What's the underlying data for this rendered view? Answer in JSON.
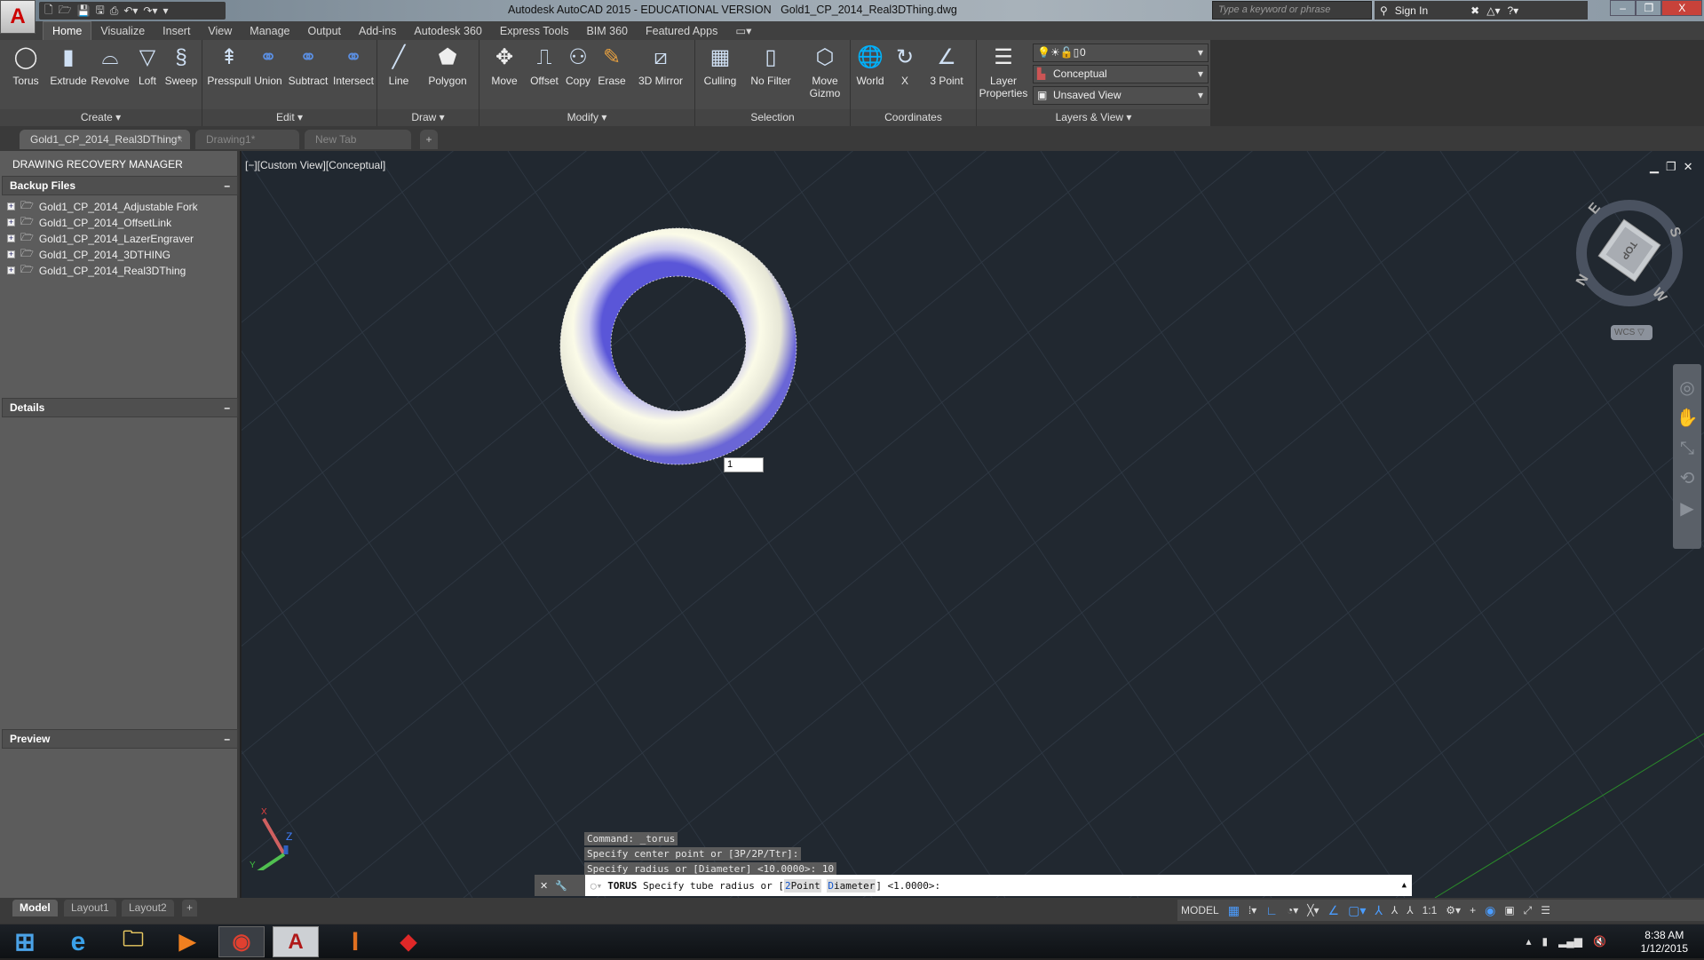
{
  "title_bar": {
    "app_title": "Autodesk AutoCAD 2015 - EDUCATIONAL VERSION",
    "document": "Gold1_CP_2014_Real3DThing.dwg",
    "search_placeholder": "Type a keyword or phrase",
    "sign_in": "Sign In",
    "window_buttons": [
      "–",
      "❐",
      "X"
    ]
  },
  "ribbon_tabs": [
    "Home",
    "Visualize",
    "Insert",
    "View",
    "Manage",
    "Output",
    "Add-ins",
    "Autodesk 360",
    "Express Tools",
    "BIM 360",
    "Featured Apps"
  ],
  "ribbon": {
    "panels": [
      "Create ▾",
      "Edit ▾",
      "Draw ▾",
      "Modify ▾",
      "Selection",
      "Coordinates",
      "Layers & View ▾"
    ],
    "buttons": {
      "torus": "Torus",
      "extrude": "Extrude",
      "revolve": "Revolve",
      "loft": "Loft",
      "sweep": "Sweep",
      "presspull": "Presspull",
      "union": "Union",
      "subtract": "Subtract",
      "intersect": "Intersect",
      "line": "Line",
      "polygon": "Polygon",
      "move": "Move",
      "offset": "Offset",
      "copy": "Copy",
      "erase": "Erase",
      "mirror3d": "3D Mirror",
      "culling": "Culling",
      "nofilter": "No Filter",
      "movegizmo": "Move Gizmo",
      "world": "World",
      "x": "X",
      "threepoint": "3 Point",
      "layerprops": "Layer Properties"
    },
    "layer_value": "0",
    "visual_style": "Conceptual",
    "view": "Unsaved View"
  },
  "doc_tabs": [
    "Gold1_CP_2014_Real3DThing*",
    "Drawing1*",
    "New Tab"
  ],
  "recovery": {
    "title": "DRAWING RECOVERY MANAGER",
    "backup_header": "Backup Files",
    "files": [
      "Gold1_CP_2014_Adjustable Fork",
      "Gold1_CP_2014_OffsetLink",
      "Gold1_CP_2014_LazerEngraver",
      "Gold1_CP_2014_3DTHING",
      "Gold1_CP_2014_Real3DThing"
    ],
    "details": "Details",
    "preview": "Preview",
    "collapse": "–"
  },
  "viewport": {
    "label": "[−][Custom View][Conceptual]",
    "input_value": "1",
    "viewcube": {
      "face": "TOP",
      "n": "N",
      "e": "E",
      "s": "S",
      "w": "W",
      "wcs": "WCS"
    },
    "ucs": {
      "x": "X",
      "y": "Y",
      "z": "Z"
    }
  },
  "command": {
    "history": [
      "Command: _torus",
      "Specify center point or [3P/2P/Ttr]:",
      "Specify radius or [Diameter] <10.0000>: 10"
    ],
    "name": "TORUS",
    "prompt": "Specify tube radius or [",
    "opt1_key": "2",
    "opt1_rest": "Point",
    "opt2_key": "D",
    "opt2_rest": "iameter",
    "suffix": "] <1.0000>:"
  },
  "layout_tabs": [
    "Model",
    "Layout1",
    "Layout2"
  ],
  "status": {
    "model": "MODEL",
    "scale": "1:1"
  },
  "taskbar": {
    "time": "8:38 AM",
    "date": "1/12/2015"
  }
}
